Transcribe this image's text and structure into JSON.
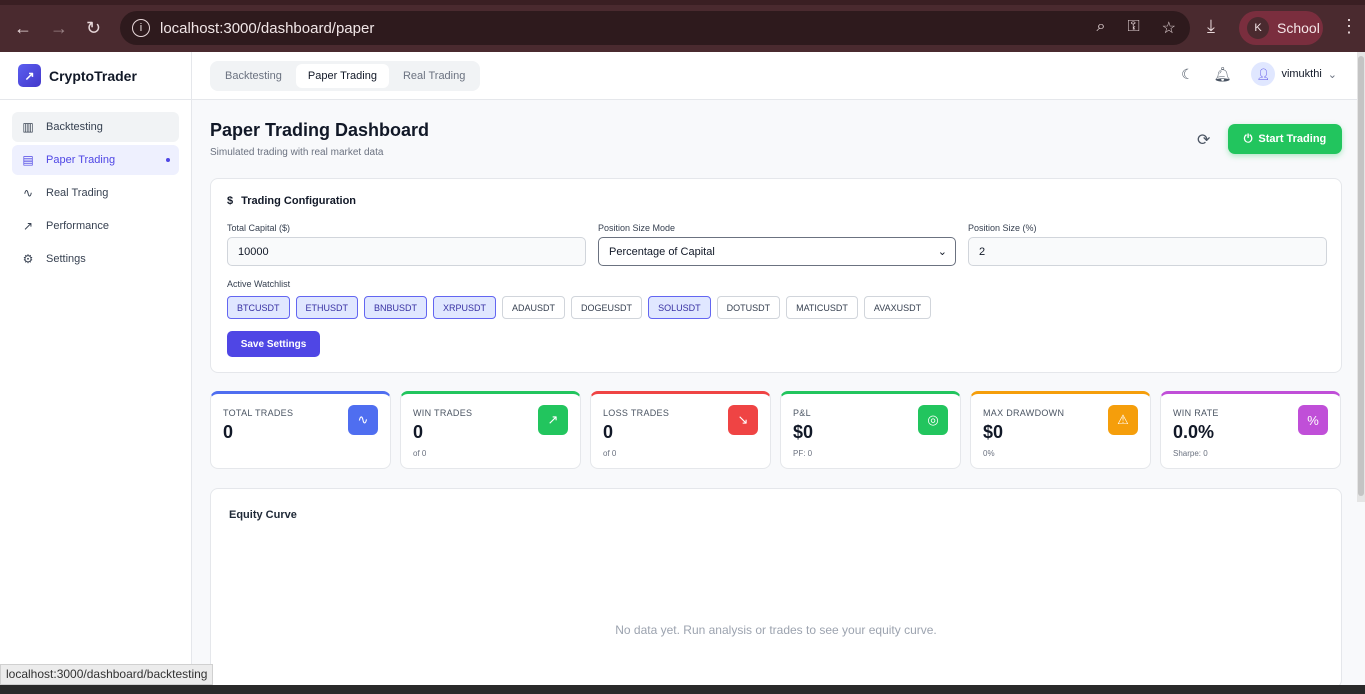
{
  "browser": {
    "url": "localhost:3000/dashboard/paper",
    "profile_initial": "K",
    "profile_name": "School",
    "status_url": "localhost:3000/dashboard/backtesting"
  },
  "brand": "CryptoTrader",
  "sidebar": {
    "items": [
      {
        "label": "Backtesting",
        "icon": "bar-chart-icon"
      },
      {
        "label": "Paper Trading",
        "icon": "document-icon"
      },
      {
        "label": "Real Trading",
        "icon": "activity-icon"
      },
      {
        "label": "Performance",
        "icon": "trending-up-icon"
      },
      {
        "label": "Settings",
        "icon": "gear-icon"
      }
    ]
  },
  "header": {
    "tabs": [
      "Backtesting",
      "Paper Trading",
      "Real Trading"
    ],
    "user": "vimukthi"
  },
  "page": {
    "title": "Paper Trading Dashboard",
    "subtitle": "Simulated trading with real market data",
    "start_label": "Start Trading"
  },
  "config": {
    "title": "Trading Configuration",
    "capital_label": "Total Capital ($)",
    "capital_value": "10000",
    "mode_label": "Position Size Mode",
    "mode_value": "Percentage of Capital",
    "size_label": "Position Size (%)",
    "size_value": "2",
    "watchlist_label": "Active Watchlist",
    "watchlist": [
      {
        "s": "BTCUSDT",
        "on": true
      },
      {
        "s": "ETHUSDT",
        "on": true
      },
      {
        "s": "BNBUSDT",
        "on": true
      },
      {
        "s": "XRPUSDT",
        "on": true
      },
      {
        "s": "ADAUSDT",
        "on": false
      },
      {
        "s": "DOGEUSDT",
        "on": false
      },
      {
        "s": "SOLUSDT",
        "on": true
      },
      {
        "s": "DOTUSDT",
        "on": false
      },
      {
        "s": "MATICUSDT",
        "on": false
      },
      {
        "s": "AVAXUSDT",
        "on": false
      }
    ],
    "save_label": "Save Settings"
  },
  "stats": [
    {
      "title": "TOTAL TRADES",
      "value": "0",
      "sub": "",
      "color": "#4f6ef0",
      "icon": "activity-icon"
    },
    {
      "title": "WIN TRADES",
      "value": "0",
      "sub": "of 0",
      "color": "#22c55e",
      "icon": "trending-up-icon"
    },
    {
      "title": "LOSS TRADES",
      "value": "0",
      "sub": "of 0",
      "color": "#ef4444",
      "icon": "trending-down-icon"
    },
    {
      "title": "P&L",
      "value": "$0",
      "sub": "PF: 0",
      "color": "#22c55e",
      "icon": "target-icon"
    },
    {
      "title": "MAX DRAWDOWN",
      "value": "$0",
      "sub": "0%",
      "color": "#f59e0b",
      "icon": "warning-icon"
    },
    {
      "title": "WIN RATE",
      "value": "0.0%",
      "sub": "Sharpe: 0",
      "color": "#c04fd8",
      "icon": "percent-icon"
    }
  ],
  "equity": {
    "title": "Equity Curve",
    "empty": "No data yet. Run analysis or trades to see your equity curve."
  }
}
